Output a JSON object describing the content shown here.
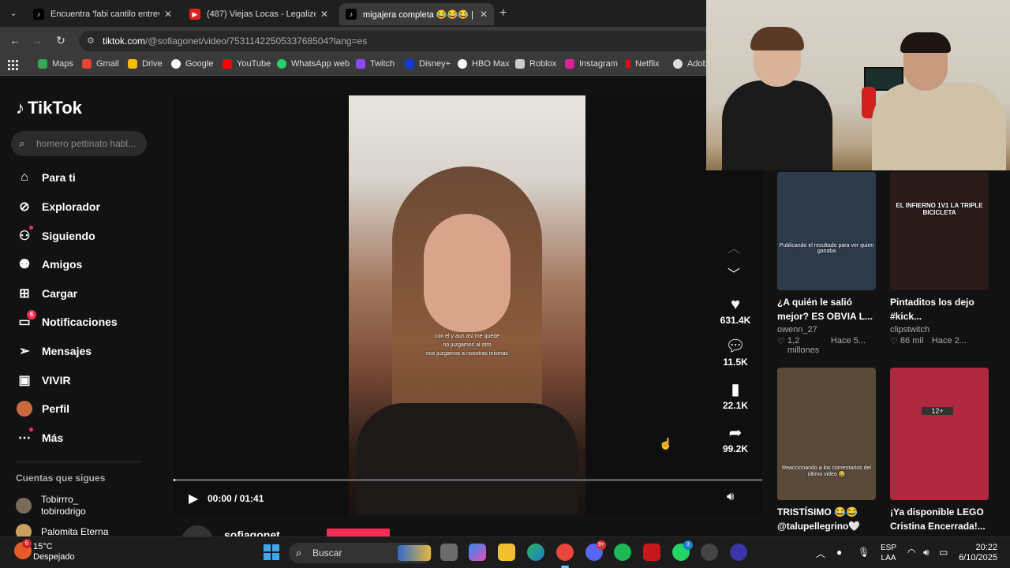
{
  "browser": {
    "tabs": [
      {
        "title": "Encuentra 'fabi cantilo entrevist",
        "icon": "tiktok-icon"
      },
      {
        "title": "(487) Viejas Locas - Legalizenla",
        "icon": "youtube-icon"
      },
      {
        "title": "migajera completa 😂😂😂 | Ti",
        "icon": "tiktok-icon"
      }
    ],
    "url_domain": "tiktok.com",
    "url_path": "/@sofiagonet/video/7531142250533768504?lang=es",
    "bookmarks": [
      "Maps",
      "Gmail",
      "Drive",
      "Google",
      "YouTube",
      "WhatsApp web",
      "Twitch",
      "Disney+",
      "HBO Max",
      "Roblox",
      "Instagram",
      "Netflix",
      "Adob"
    ]
  },
  "tiktok": {
    "logo": "TikTok",
    "search_placeholder": "homero pettinato habl...",
    "nav": [
      {
        "label": "Para ti",
        "icon": "home-icon"
      },
      {
        "label": "Explorador",
        "icon": "compass-icon"
      },
      {
        "label": "Siguiendo",
        "icon": "following-icon"
      },
      {
        "label": "Amigos",
        "icon": "friends-icon"
      },
      {
        "label": "Cargar",
        "icon": "upload-icon"
      },
      {
        "label": "Notificaciones",
        "icon": "inbox-icon",
        "badge": "6"
      },
      {
        "label": "Mensajes",
        "icon": "send-icon"
      },
      {
        "label": "VIVIR",
        "icon": "live-icon"
      },
      {
        "label": "Perfil",
        "icon": "avatar"
      },
      {
        "label": "Más",
        "icon": "more-icon"
      }
    ],
    "following_title": "Cuentas que sigues",
    "following": [
      {
        "name": "Tobirrro_",
        "handle": "tobirodrigo"
      },
      {
        "name": "Palomita Eterna",
        "handle": ""
      }
    ],
    "video": {
      "subtitle_lines": [
        "con el y aun así me quede",
        "no juzgamos al otro",
        "nos juzgamos a nosotras mismas"
      ],
      "current_time": "00:00 / 01:41",
      "progress": 0.003
    },
    "actions": [
      {
        "name": "like",
        "icon": "heart-icon",
        "count": "631.4K"
      },
      {
        "name": "comment",
        "icon": "comment-icon",
        "count": "11.5K"
      },
      {
        "name": "save",
        "icon": "bookmark-icon",
        "count": "22.1K"
      },
      {
        "name": "share",
        "icon": "share-icon",
        "count": "99.2K"
      }
    ],
    "author": "sofiagonet",
    "related": [
      {
        "caption1": "¿A quién le salió",
        "caption2": "mejor? ES OBVIA L...",
        "user": "owenn_27",
        "likes": "1,2 millones",
        "age": "Hace 5...",
        "thumb_text": "Publicando el resultado para ver quien ganaba",
        "thumb_color": "#2d3a4a"
      },
      {
        "caption1": "Pintaditos los dejo",
        "caption2": "#kick...",
        "user": "clipstwitch",
        "likes": "86 mil",
        "age": "Hace 2...",
        "thumb_text": "EL INFIERNO 1V1 LA TRIPLE BICICLETA",
        "thumb_color": "#2a1a1a"
      },
      {
        "caption1": "TRISTÍSIMO 😂😂",
        "caption2": "@talupellegrino🤍",
        "user": "",
        "likes": "",
        "age": "",
        "thumb_text": "Reaccionando a los comentarios del último video 😂",
        "thumb_color": "#5a4a3a"
      },
      {
        "caption1": "¡Ya disponible LEGO",
        "caption2": "Cristina Encerrada!...",
        "user": "",
        "likes": "",
        "age": "",
        "thumb_text": "12+",
        "thumb_color": "#b02840"
      }
    ]
  },
  "taskbar": {
    "temperature": "15°C",
    "condition": "Despejado",
    "weather_badge": "6",
    "search_label": "Buscar",
    "lang_top": "ESP",
    "lang_bottom": "LAA",
    "time": "20:22",
    "date": "6/10/2025"
  }
}
